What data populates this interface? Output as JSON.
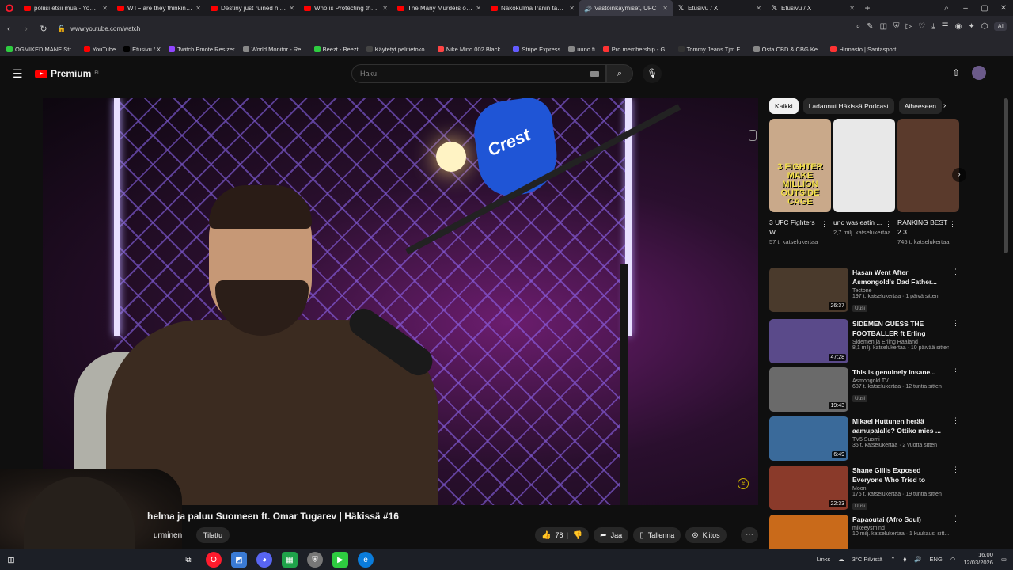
{
  "browser": {
    "tabs": [
      {
        "title": "poliisi etsii mua - YouTube",
        "icon": "youtube",
        "active": false
      },
      {
        "title": "WTF are they thinking? - Y",
        "icon": "youtube",
        "active": false
      },
      {
        "title": "Destiny just ruined his car",
        "icon": "youtube",
        "active": false
      },
      {
        "title": "Who is Protecting the Jeff",
        "icon": "youtube",
        "active": false
      },
      {
        "title": "The Many Murders of Jeffr",
        "icon": "youtube",
        "active": false
      },
      {
        "title": "Näkökulma Iranin tapahtu",
        "icon": "youtube",
        "active": false
      },
      {
        "title": "Vastoinkäymiset, UFC",
        "icon": "audio",
        "active": true
      },
      {
        "title": "Etusivu / X",
        "icon": "x",
        "active": false
      },
      {
        "title": "Etusivu / X",
        "icon": "x",
        "active": false
      }
    ],
    "url": "www.youtube.com/watch",
    "ai_label": "AI",
    "bookmarks": [
      {
        "label": "OGMIKEDIMANE Str...",
        "color": "#2ecc40"
      },
      {
        "label": "YouTube",
        "color": "#ff0000"
      },
      {
        "label": "Etusivu / X",
        "color": "#000000"
      },
      {
        "label": "Twitch Emote Resizer",
        "color": "#9146ff"
      },
      {
        "label": "World Monitor - Re...",
        "color": "#888888"
      },
      {
        "label": "Beezt - Beezt",
        "color": "#2ecc40"
      },
      {
        "label": "Käytetyt pelitietoko...",
        "color": "#444444"
      },
      {
        "label": "Nike Mind 002 Black...",
        "color": "#ff4444"
      },
      {
        "label": "Stripe Express",
        "color": "#635bff"
      },
      {
        "label": "uuno.fi",
        "color": "#888888"
      },
      {
        "label": "Pro membership - G...",
        "color": "#ff3333"
      },
      {
        "label": "Tommy Jeans Tjm E...",
        "color": "#333333"
      },
      {
        "label": "Osta CBD & CBG Ke...",
        "color": "#888888"
      },
      {
        "label": "Hinnasto | Santasport",
        "color": "#ff3333"
      }
    ]
  },
  "youtube": {
    "logo_text": "Premium",
    "logo_sup": "FI",
    "search_placeholder": "Haku",
    "video": {
      "title": "helma ja paluu Suomeen ft. Omar Tugarev | Häkissä #16",
      "channel": "urminen",
      "subscribe_label": "Tilattu",
      "likes": "78",
      "share_label": "Jaa",
      "save_label": "Tallenna",
      "thanks_label": "Kiitos"
    },
    "chips": [
      "Kaikki",
      "Ladannut Häkissä Podcast",
      "Aiheeseen"
    ],
    "shorts": [
      {
        "title": "3 UFC Fighters W...",
        "views": "57 t. katselukertaa",
        "caption": "3 FIGHTER MAKE MILLION OUTSIDE CAGE",
        "bg": "#c9a98a"
      },
      {
        "title": "unc was eatin ...",
        "views": "2,7 milj. katselukertaa",
        "caption": "",
        "bg": "#e8e8e8"
      },
      {
        "title": "RANKING BEST 2 3 ...",
        "views": "745 t. katselukertaa",
        "caption": "",
        "bg": "#5a3a2c"
      }
    ],
    "recommendations": [
      {
        "title": "Hasan Went After Asmongold's Dad Father...",
        "channel": "Tectone",
        "meta": "197 t. katselukertaa · 1 päivä sitten",
        "badge": "Uusi",
        "duration": "26:37",
        "bg": "#4a3a2c"
      },
      {
        "title": "SIDEMEN GUESS THE FOOTBALLER ft Erling Haaland",
        "channel": "Sidemen ja Erling Haaland",
        "meta": "8,1 milj. katselukertaa · 10 päivää sitten",
        "badge": "",
        "duration": "47:28",
        "bg": "#5a4a8a"
      },
      {
        "title": "This is genuinely insane...",
        "channel": "Asmongold TV",
        "meta": "687 t. katselukertaa · 12 tuntia sitten",
        "badge": "Uusi",
        "duration": "19:43",
        "bg": "#6a6a6a"
      },
      {
        "title": "Mikael Huttunen herää aamupalalle? Ottiko mies ...",
        "channel": "TV5 Suomi",
        "meta": "35 t. katselukertaa · 2 vuotta sitten",
        "badge": "",
        "duration": "6:49",
        "bg": "#3a6a9a"
      },
      {
        "title": "Shane Gillis Exposed Everyone Who Tried to Destroy Him",
        "channel": "Moon",
        "meta": "176 t. katselukertaa · 19 tuntia sitten",
        "badge": "Uusi",
        "duration": "22:33",
        "bg": "#8a3a2a"
      },
      {
        "title": "Papaoutai (Afro Soul)",
        "channel": "mikeeysmind",
        "meta": "10 milj. katselukertaa · 1 kuukausi sitt...",
        "badge": "",
        "duration": "",
        "bg": "#c96a1a"
      }
    ]
  },
  "taskbar": {
    "links_label": "Links",
    "weather": "3°C Pilvistä",
    "lang": "ENG",
    "time": "16.00",
    "date": "12/03/2026"
  }
}
